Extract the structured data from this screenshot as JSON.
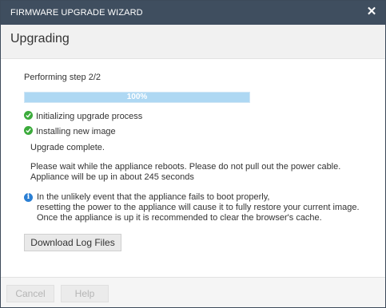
{
  "window": {
    "title": "FIRMWARE UPGRADE WIZARD",
    "close_icon": "close-icon"
  },
  "header": {
    "heading": "Upgrading"
  },
  "main": {
    "step_text": "Performing step 2/2",
    "progress": {
      "value": 1.0,
      "label": "100%",
      "fill_color": "#aed8f3"
    },
    "steps": [
      {
        "label": "Initializing upgrade process",
        "status": "done",
        "icon": "check-circle-icon"
      },
      {
        "label": "Installing new image",
        "status": "done",
        "icon": "check-circle-icon"
      }
    ],
    "complete_text": "Upgrade complete.",
    "wait_text": {
      "line1": "Please wait while the appliance reboots. Please do not pull out the power cable.",
      "line2": "Appliance will be up in about 245 seconds"
    },
    "info": {
      "icon": "info-icon",
      "line1": "In the unlikely event that the appliance fails to boot properly,",
      "line2": "resetting the power to the appliance will cause it to fully restore your current image.",
      "line3": "Once the appliance is up it is recommended to clear the browser's cache."
    },
    "download_button": "Download Log Files"
  },
  "footer": {
    "cancel_label": "Cancel",
    "help_label": "Help"
  },
  "colors": {
    "titlebar": "#3f4e5f",
    "success": "#3cab3c",
    "info": "#2a7fd4"
  }
}
